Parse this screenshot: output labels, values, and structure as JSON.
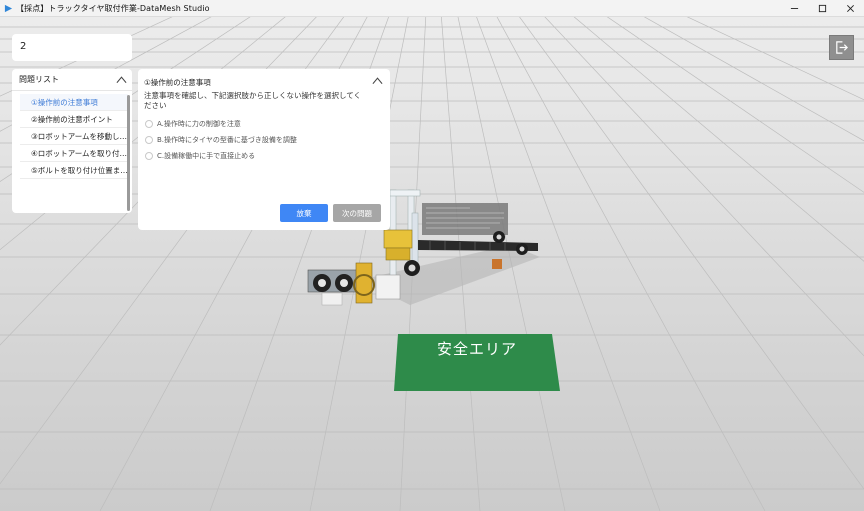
{
  "window": {
    "title": "【採点】トラックタイヤ取付作業-DataMesh Studio"
  },
  "question_number_field": {
    "value": "2"
  },
  "question_list": {
    "header": "問題リスト",
    "items": [
      {
        "label": "①操作前の注意事項",
        "active": true
      },
      {
        "label": "②操作前の注意ポイント",
        "active": false
      },
      {
        "label": "③ロボットアームを移動し…",
        "active": false
      },
      {
        "label": "④ロボットアームを取り付…",
        "active": false
      },
      {
        "label": "⑤ボルトを取り付け位置ま…",
        "active": false
      }
    ]
  },
  "question_panel": {
    "title": "①操作前の注意事項",
    "description": "注意事項を確認し、下記選択肢から正しくない操作を選択してください",
    "options": [
      "A.操作時に力の制御を注意",
      "B.操作時にタイヤの型番に基づき設備を調整",
      "C.設備稼働中に手で直接止める"
    ],
    "submit_label": "放棄",
    "next_label": "次の問題"
  },
  "scene": {
    "safety_area_label": "安全エリア",
    "safety_area_color": "#2e8b4a",
    "accent_color": "#3f87f5"
  },
  "icons": {
    "app": "app-logo-icon",
    "exit": "exit-icon",
    "collapse": "chevron-up-icon"
  }
}
